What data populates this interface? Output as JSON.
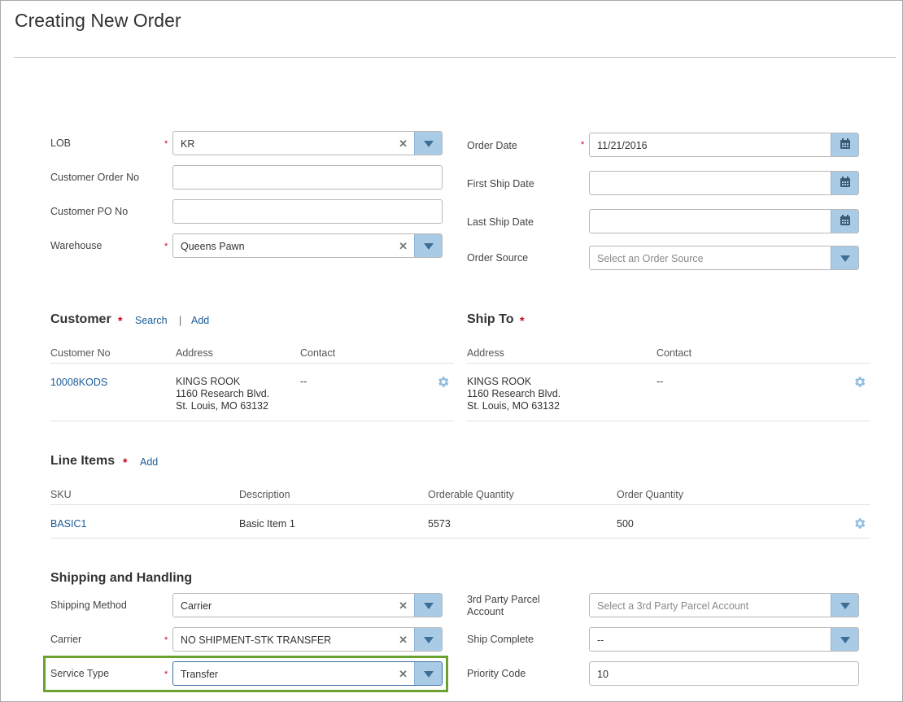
{
  "page": {
    "title": "Creating New Order"
  },
  "order_form": {
    "lob": {
      "label": "LOB",
      "value": "KR"
    },
    "customer_order_no": {
      "label": "Customer Order No",
      "value": ""
    },
    "customer_po_no": {
      "label": "Customer PO No",
      "value": ""
    },
    "warehouse": {
      "label": "Warehouse",
      "value": "Queens Pawn"
    },
    "order_date": {
      "label": "Order Date",
      "value": "11/21/2016"
    },
    "first_ship_date": {
      "label": "First Ship Date",
      "value": ""
    },
    "last_ship_date": {
      "label": "Last Ship Date",
      "value": ""
    },
    "order_source": {
      "label": "Order Source",
      "placeholder": "Select an Order Source"
    }
  },
  "customer": {
    "title": "Customer",
    "search_label": "Search",
    "separator": "|",
    "add_label": "Add",
    "columns": [
      "Customer No",
      "Address",
      "Contact"
    ],
    "row": {
      "customer_no": "10008KODS",
      "address_line1": "KINGS ROOK",
      "address_line2": "1160 Research Blvd.",
      "address_line3": "St. Louis, MO 63132",
      "contact": "--"
    }
  },
  "ship_to": {
    "title": "Ship To",
    "columns": [
      "Address",
      "Contact"
    ],
    "row": {
      "address_line1": "KINGS ROOK",
      "address_line2": "1160 Research Blvd.",
      "address_line3": "St. Louis, MO 63132",
      "contact": "--"
    }
  },
  "line_items": {
    "title": "Line Items",
    "add_label": "Add",
    "columns": [
      "SKU",
      "Description",
      "Orderable Quantity",
      "Order Quantity"
    ],
    "rows": [
      {
        "sku": "BASIC1",
        "description": "Basic Item 1",
        "orderable_quantity": "5573",
        "order_quantity": "500"
      }
    ]
  },
  "shipping": {
    "title": "Shipping and Handling",
    "shipping_method": {
      "label": "Shipping Method",
      "value": "Carrier"
    },
    "carrier": {
      "label": "Carrier",
      "value": "NO SHIPMENT-STK TRANSFER"
    },
    "service_type": {
      "label": "Service Type",
      "value": "Transfer"
    },
    "third_party_account": {
      "label_line1": "3rd Party Parcel",
      "label_line2": "Account",
      "placeholder": "Select a 3rd Party Parcel Account"
    },
    "ship_complete": {
      "label": "Ship Complete",
      "value": "--"
    },
    "priority_code": {
      "label": "Priority Code",
      "value": "10"
    }
  },
  "required_marker": "*",
  "colors": {
    "accent": "#a9cbe6",
    "link": "#1a5a96",
    "required": "#d0021b",
    "highlight": "#6aa22e",
    "gear": "#8fbde0"
  },
  "icons": {
    "clear": "x-icon",
    "dropdown": "chevron-down-icon",
    "calendar": "calendar-icon",
    "settings": "gear-icon"
  }
}
